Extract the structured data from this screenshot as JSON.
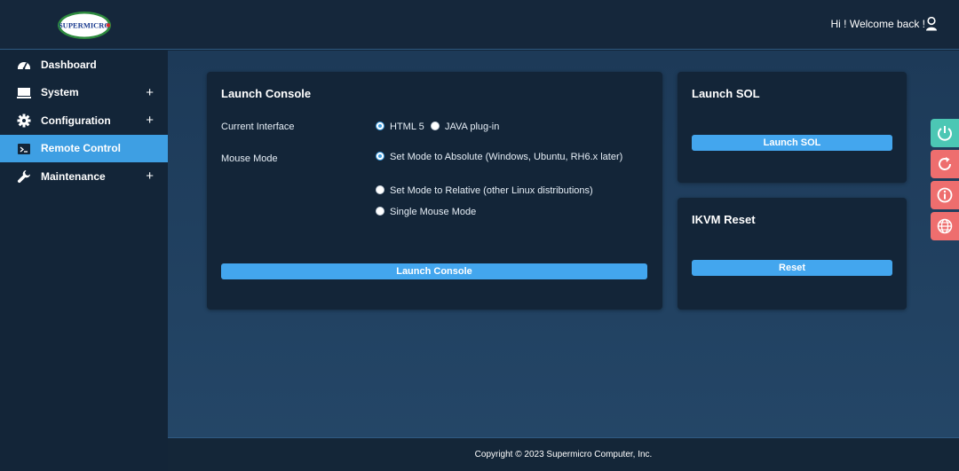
{
  "header": {
    "logo_text": "SUPERMICRO",
    "welcome": "Hi ! Welcome back !"
  },
  "sidebar": {
    "items": [
      {
        "label": "Dashboard",
        "icon": "dashboard-icon",
        "expandable": false,
        "active": false
      },
      {
        "label": "System",
        "icon": "monitor-icon",
        "expandable": true,
        "active": false
      },
      {
        "label": "Configuration",
        "icon": "gear-icon",
        "expandable": true,
        "active": false
      },
      {
        "label": "Remote Control",
        "icon": "terminal-icon",
        "expandable": false,
        "active": true
      },
      {
        "label": "Maintenance",
        "icon": "wrench-icon",
        "expandable": true,
        "active": false
      }
    ],
    "expand_symbol": "+"
  },
  "console": {
    "title": "Launch Console",
    "interface_label": "Current Interface",
    "interface_options": [
      "HTML 5",
      "JAVA plug-in"
    ],
    "interface_selected": "HTML 5",
    "mouse_label": "Mouse Mode",
    "mouse_options": [
      "Set Mode to Absolute (Windows, Ubuntu, RH6.x later)",
      "Set Mode to Relative (other Linux distributions)",
      "Single Mouse Mode"
    ],
    "mouse_selected": "Set Mode to Absolute (Windows, Ubuntu, RH6.x later)",
    "button": "Launch Console"
  },
  "sol": {
    "title": "Launch SOL",
    "button": "Launch SOL"
  },
  "ikvm": {
    "title": "IKVM Reset",
    "button": "Reset"
  },
  "quick_actions": [
    {
      "icon": "power-icon",
      "color": "#4cc7b4"
    },
    {
      "icon": "refresh-icon",
      "color": "#ee6e6e"
    },
    {
      "icon": "info-icon",
      "color": "#ee6e6e"
    },
    {
      "icon": "globe-icon",
      "color": "#ee6e6e"
    }
  ],
  "footer": {
    "copyright": "Copyright © 2023 Supermicro Computer, Inc."
  },
  "colors": {
    "accent": "#3e9fe3",
    "panel": "#132538",
    "background": "#1d3a58"
  }
}
